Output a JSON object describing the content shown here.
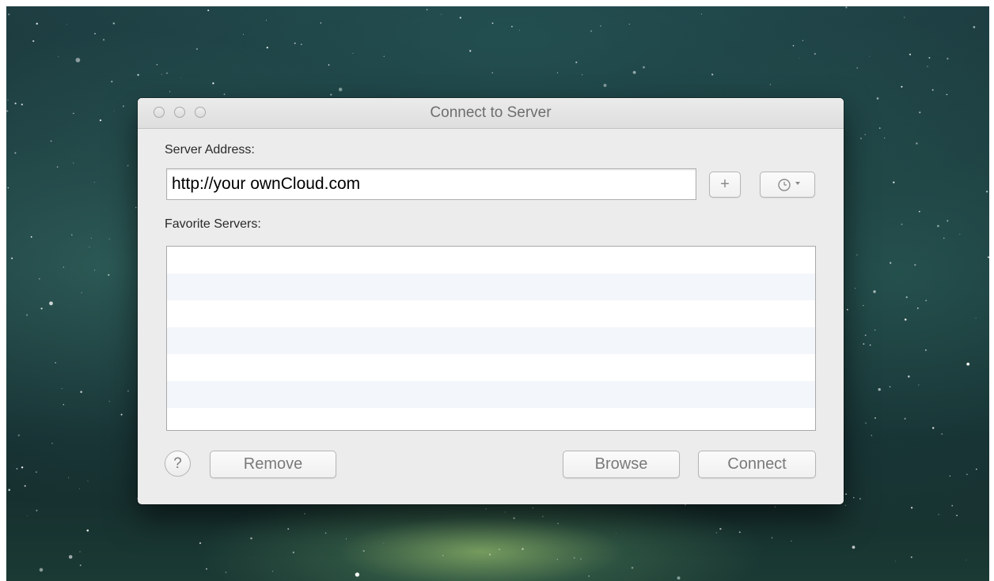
{
  "window": {
    "title": "Connect to Server"
  },
  "form": {
    "server_address_label": "Server Address:",
    "server_address_value": "http://your ownCloud.com",
    "favorite_servers_label": "Favorite Servers:",
    "favorite_servers": []
  },
  "buttons": {
    "add_favorite": "+",
    "help": "?",
    "remove": "Remove",
    "browse": "Browse",
    "connect": "Connect"
  },
  "icons": {
    "recent_servers": "clock-icon",
    "dropdown": "chevron-down-icon",
    "close": "close-icon",
    "minimize": "minimize-icon",
    "zoom": "zoom-icon"
  },
  "colors": {
    "window_background": "#ececec",
    "list_stripe": "#f3f6fa"
  }
}
